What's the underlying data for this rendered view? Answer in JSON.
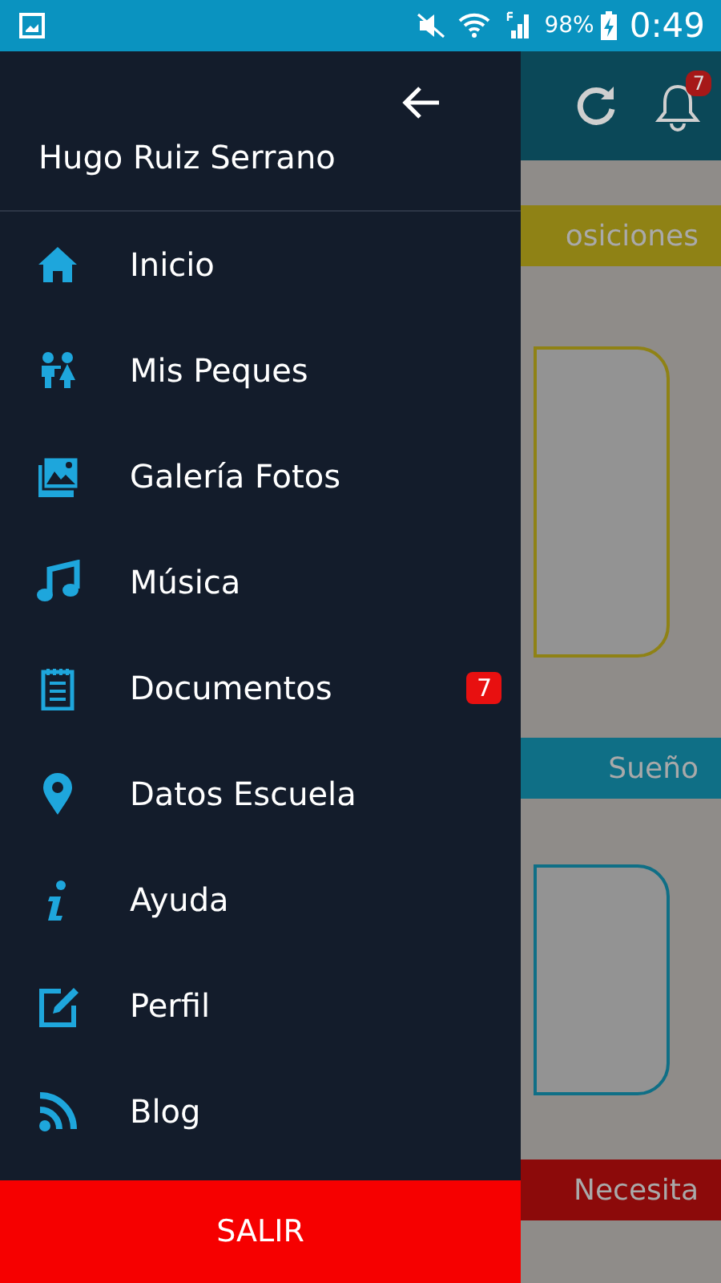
{
  "status_bar": {
    "battery": "98%",
    "time": "0:49"
  },
  "drawer": {
    "user_name": "Hugo Ruiz Serrano",
    "items": [
      {
        "label": "Inicio"
      },
      {
        "label": "Mis Peques"
      },
      {
        "label": "Galería Fotos"
      },
      {
        "label": "Música"
      },
      {
        "label": "Documentos",
        "badge": "7"
      },
      {
        "label": "Datos Escuela"
      },
      {
        "label": "Ayuda"
      },
      {
        "label": "Perfil"
      },
      {
        "label": "Blog"
      }
    ],
    "logout_button": "SALIR"
  },
  "background": {
    "notification_badge": "7",
    "sections": [
      {
        "label": "osiciones",
        "color": "#8f8215"
      },
      {
        "label": "Sueño",
        "color": "#0f6f86"
      },
      {
        "label": "Necesita",
        "color": "#8c0a0a"
      }
    ]
  }
}
